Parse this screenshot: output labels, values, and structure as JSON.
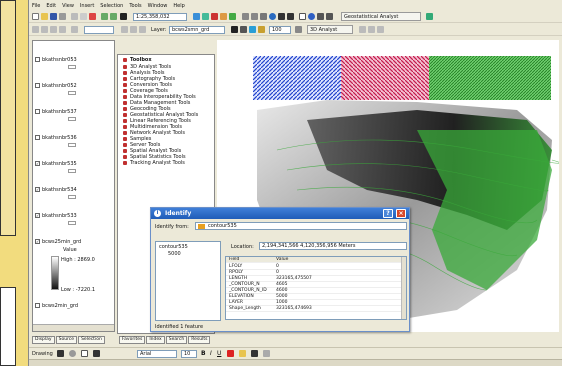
{
  "menu": [
    "File",
    "Edit",
    "View",
    "Insert",
    "Selection",
    "Tools",
    "Window",
    "Help"
  ],
  "toolbar": {
    "scale": "1:25,358,032",
    "layer_label": "Layer:",
    "layer_value": "bcws2smn_grd",
    "opacity": "100",
    "arcview": "3D Analyst",
    "geostat": "Geostatistical Analyst"
  },
  "toc": {
    "layers": [
      "bkathsnbr053",
      "bkathsnbr052",
      "bkathsnbr537",
      "bkathsnbr536",
      "bkathsnbr535",
      "bkathsnbr534",
      "bkathsnbr533",
      "bcws25min_grd",
      "bcws2min_grd"
    ],
    "value_label": "Value",
    "high": "High : 2869.0",
    "low": "Low : -7220.1"
  },
  "tools": {
    "root": "Toolbox",
    "items": [
      "3D Analyst Tools",
      "Analysis Tools",
      "Cartography Tools",
      "Conversion Tools",
      "Coverage Tools",
      "Data Interoperability Tools",
      "Data Management Tools",
      "Geocoding Tools",
      "Geostatistical Analyst Tools",
      "Linear Referencing Tools",
      "Multidimension Tools",
      "Network Analyst Tools",
      "Samples",
      "Server Tools",
      "Spatial Analyst Tools",
      "Spatial Statistics Tools",
      "Tracking Analyst Tools"
    ]
  },
  "tabs_left": [
    "Display",
    "Source",
    "Selection"
  ],
  "tabs_right": [
    "Favorites",
    "Index",
    "Search",
    "Results"
  ],
  "identify": {
    "title": "Identify",
    "from_label": "Identify from:",
    "from_value": "contour535",
    "tree_root": "contour535",
    "tree_child": "5000",
    "location_label": "Location:",
    "location_value": "2,194,341,566   4,120,356,956 Meters",
    "col_field": "Field",
    "col_value": "Value",
    "rows": [
      {
        "f": "LFOLY",
        "v": "0"
      },
      {
        "f": "RPOLY",
        "v": "0"
      },
      {
        "f": "LENGTH",
        "v": "323165,475507"
      },
      {
        "f": "_CONTOUR_N",
        "v": "4605"
      },
      {
        "f": "_CONTOUR_N_ID",
        "v": "4600"
      },
      {
        "f": "ELEVATION",
        "v": "5000"
      },
      {
        "f": "LAYER",
        "v": "1000"
      },
      {
        "f": "Shape_Length",
        "v": "323165,474693"
      }
    ],
    "status": "Identified 1 feature"
  },
  "bottom": {
    "drawing": "Drawing",
    "font": "Arial",
    "size": "10"
  },
  "colors": {
    "map_blue": "#2244cc",
    "map_red": "#c41a4c",
    "map_green": "#3aa93a",
    "title_blue": "#1f5cb8"
  }
}
